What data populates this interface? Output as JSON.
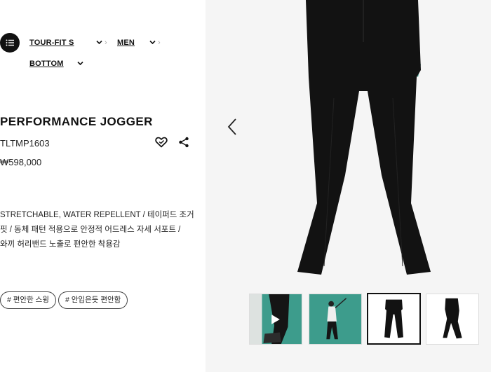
{
  "breadcrumb": {
    "items": [
      "TOUR-FIT S",
      "MEN",
      "BOTTOM"
    ]
  },
  "product": {
    "name": "PERFORMANCE JOGGER",
    "code": "TLTMP1603",
    "price": "₩598,000",
    "description_lines": [
      "STRETCHABLE, WATER REPELLENT / 테이퍼드 조거",
      "핏 / 동체 패턴 적용으로 안정적 어드레스 자세 서포트 /",
      "와끼 허리밴드 노출로 편안한 착용감"
    ],
    "tags": [
      "# 편안한 스윙",
      "# 안입은듯 편안함"
    ]
  },
  "icons": {
    "menu": "list-icon",
    "wishlist": "heart-icon",
    "share": "share-icon",
    "prev": "chevron-left-icon",
    "play": "play-icon"
  },
  "gallery": {
    "active_index": 2,
    "thumbnail_count": 4
  },
  "colors": {
    "gallery_bg": "#f5f5f5",
    "pants": "#121212",
    "teal_bg": "#3d9c8c",
    "accent_dark": "#111111"
  }
}
